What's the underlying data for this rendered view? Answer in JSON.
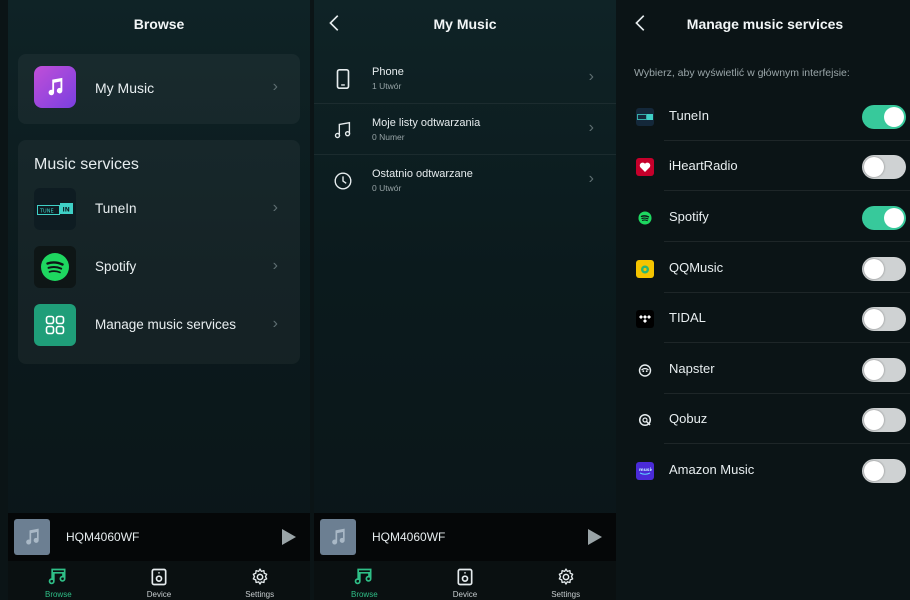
{
  "browse": {
    "title": "Browse",
    "my_music": "My Music",
    "section_title": "Music services",
    "services": [
      {
        "label": "TuneIn",
        "icon": "tunein-icon"
      },
      {
        "label": "Spotify",
        "icon": "spotify-icon"
      },
      {
        "label": "Manage music services",
        "icon": "grid-icon"
      }
    ]
  },
  "my_music": {
    "title": "My Music",
    "items": [
      {
        "title": "Phone",
        "subtitle": "1 Utwór",
        "icon": "phone-icon"
      },
      {
        "title": "Moje listy odtwarzania",
        "subtitle": "0 Numer",
        "icon": "music-note-icon"
      },
      {
        "title": "Ostatnio odtwarzane",
        "subtitle": "0 Utwór",
        "icon": "clock-icon"
      }
    ]
  },
  "manage": {
    "title": "Manage music services",
    "instruction": "Wybierz, aby wyświetlić w głównym interfejsie:",
    "services": [
      {
        "name": "TuneIn",
        "enabled": true,
        "icon": "tunein-icon",
        "color": "#1a2a3a"
      },
      {
        "name": "iHeartRadio",
        "enabled": false,
        "icon": "iheartradio-icon",
        "color": "#c6002b"
      },
      {
        "name": "Spotify",
        "enabled": true,
        "icon": "spotify-icon",
        "color": "#1db954"
      },
      {
        "name": "QQMusic",
        "enabled": false,
        "icon": "qqmusic-icon",
        "color": "#f5c400"
      },
      {
        "name": "TIDAL",
        "enabled": false,
        "icon": "tidal-icon",
        "color": "#000000"
      },
      {
        "name": "Napster",
        "enabled": false,
        "icon": "napster-icon",
        "color": "#111111"
      },
      {
        "name": "Qobuz",
        "enabled": false,
        "icon": "qobuz-icon",
        "color": "#111111"
      },
      {
        "name": "Amazon Music",
        "enabled": false,
        "icon": "amazon-music-icon",
        "color": "#4a2bd8"
      }
    ]
  },
  "player": {
    "device_name": "HQM4060WF"
  },
  "tabs": [
    {
      "label": "Browse",
      "icon": "browse-icon"
    },
    {
      "label": "Device",
      "icon": "device-icon"
    },
    {
      "label": "Settings",
      "icon": "gear-icon"
    }
  ],
  "colors": {
    "accent": "#37c99b",
    "toggle_off": "#cfd2d3"
  }
}
